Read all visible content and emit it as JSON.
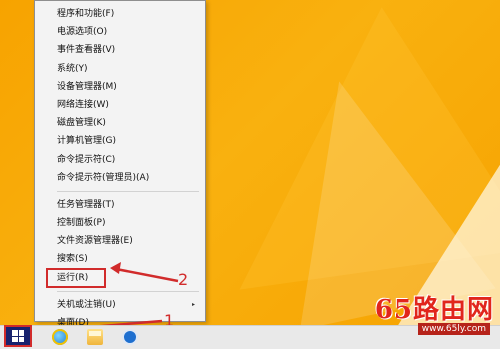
{
  "context_menu": {
    "items_top": [
      "程序和功能(F)",
      "电源选项(O)",
      "事件查看器(V)",
      "系统(Y)",
      "设备管理器(M)",
      "网络连接(W)",
      "磁盘管理(K)",
      "计算机管理(G)",
      "命令提示符(C)",
      "命令提示符(管理员)(A)"
    ],
    "items_middle": [
      "任务管理器(T)",
      "控制面板(P)",
      "文件资源管理器(E)",
      "搜索(S)",
      "运行(R)"
    ],
    "items_bottom": [
      "关机或注销(U)",
      "桌面(D)"
    ],
    "submenu_arrow": "▸"
  },
  "annotations": {
    "label_1": "1",
    "label_2": "2",
    "color": "#d12b2b"
  },
  "taskbar": {
    "icons": [
      "start-windows-icon",
      "internet-explorer-icon",
      "file-explorer-icon",
      "clock-app-icon"
    ]
  },
  "watermark": {
    "title": "65路由网",
    "url": "www.65ly.com"
  },
  "colors": {
    "desktop": "#f7a300",
    "start_button": "#18226e",
    "annotation": "#d12b2b"
  }
}
